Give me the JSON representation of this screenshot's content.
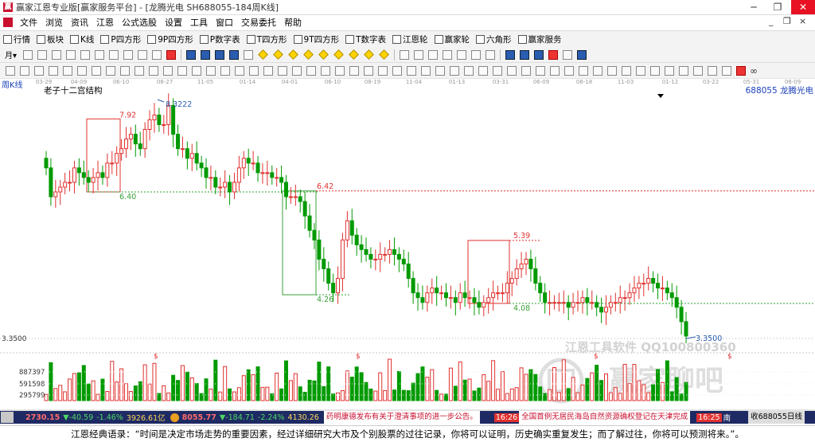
{
  "window": {
    "title": "赢家江恩专业版[赢家服务平台] - [龙腾光电  SH688055-184周K线]",
    "icon": "yingjia-logo-icon"
  },
  "menu": [
    "文件",
    "浏览",
    "资讯",
    "江恩",
    "公式选股",
    "设置",
    "工具",
    "窗口",
    "交易委托",
    "帮助"
  ],
  "toolbar1": [
    {
      "label": "行情",
      "icon": "grid-icon"
    },
    {
      "label": "板块",
      "icon": "blocks-icon"
    },
    {
      "label": "K线",
      "icon": "candle-icon"
    },
    {
      "label": "P四方形",
      "icon": "p-square-icon"
    },
    {
      "label": "9P四方形",
      "icon": "9p-square-icon"
    },
    {
      "label": "P数字表",
      "icon": "p-table-icon"
    },
    {
      "label": "T四方形",
      "icon": "t-square-icon"
    },
    {
      "label": "9T四方形",
      "icon": "9t-square-icon"
    },
    {
      "label": "T数字表",
      "icon": "t-table-icon"
    },
    {
      "label": "江恩轮",
      "icon": "gann-wheel-icon"
    },
    {
      "label": "赢家轮",
      "icon": "winner-wheel-icon"
    },
    {
      "label": "六角形",
      "icon": "hexagon-icon"
    },
    {
      "label": "赢家服务",
      "icon": "dollar-icon"
    }
  ],
  "chart": {
    "period_label": "周K线",
    "indicator_name": "老子十二宫结构",
    "stock_label": "688055 龙腾光电",
    "date_ticks": [
      "03-29",
      "04-09",
      "06-10",
      "08-27",
      "11-05",
      "01-14",
      "04-01",
      "06-10",
      "08-19",
      "11-04",
      "01-13",
      "03-31",
      "06-09",
      "08-18",
      "11-03",
      "01-12",
      "03-22",
      "05-31",
      "08-09"
    ],
    "price_high": "8.3222",
    "price_low": "3.3500",
    "box_annotations": [
      "7.92",
      "6.40",
      "6.42",
      "4.26",
      "5.39",
      "4.08"
    ],
    "hline_price": "3.3500",
    "volume_ticks": [
      "887397",
      "591598",
      "295799"
    ],
    "volume_marks": [
      "$",
      "$",
      "$",
      "$"
    ],
    "watermark_line1": "江恩工具软件  QQ100800360",
    "watermark_line2": "赢家聊吧",
    "colors": {
      "up": "#e0312f",
      "down": "#009a00",
      "box_red": "#e0312f",
      "box_green": "#3aa03a",
      "dash_green": "#2ca02c",
      "dash_red": "#e0312f",
      "axis": "#c8c8c8"
    }
  },
  "status": {
    "sh_index": "2730.15",
    "sh_change": "▼-40.59",
    "sh_pct": "-1.46%",
    "sh_amount": "3926.61亿",
    "sz_index": "8055.77",
    "sz_change": "▼-184.71",
    "sz_pct": "-2.24%",
    "sz_amount": "4130.26",
    "news1": "药明康德发布有关于澄清事项的进一步公告。",
    "time1": "16:26",
    "news2": "全国首例无居民海岛自然资源确权登记在天津完成",
    "time2": "16:25",
    "tail": "南",
    "right_label": "收688055日线"
  },
  "quote": "江恩经典语录：“时间是决定市场走势的重要因素，经过详细研究大市及个别股票的过往记录，你将可以证明，历史确实重复发生；而了解过往，你将可以预测将来。”。"
}
